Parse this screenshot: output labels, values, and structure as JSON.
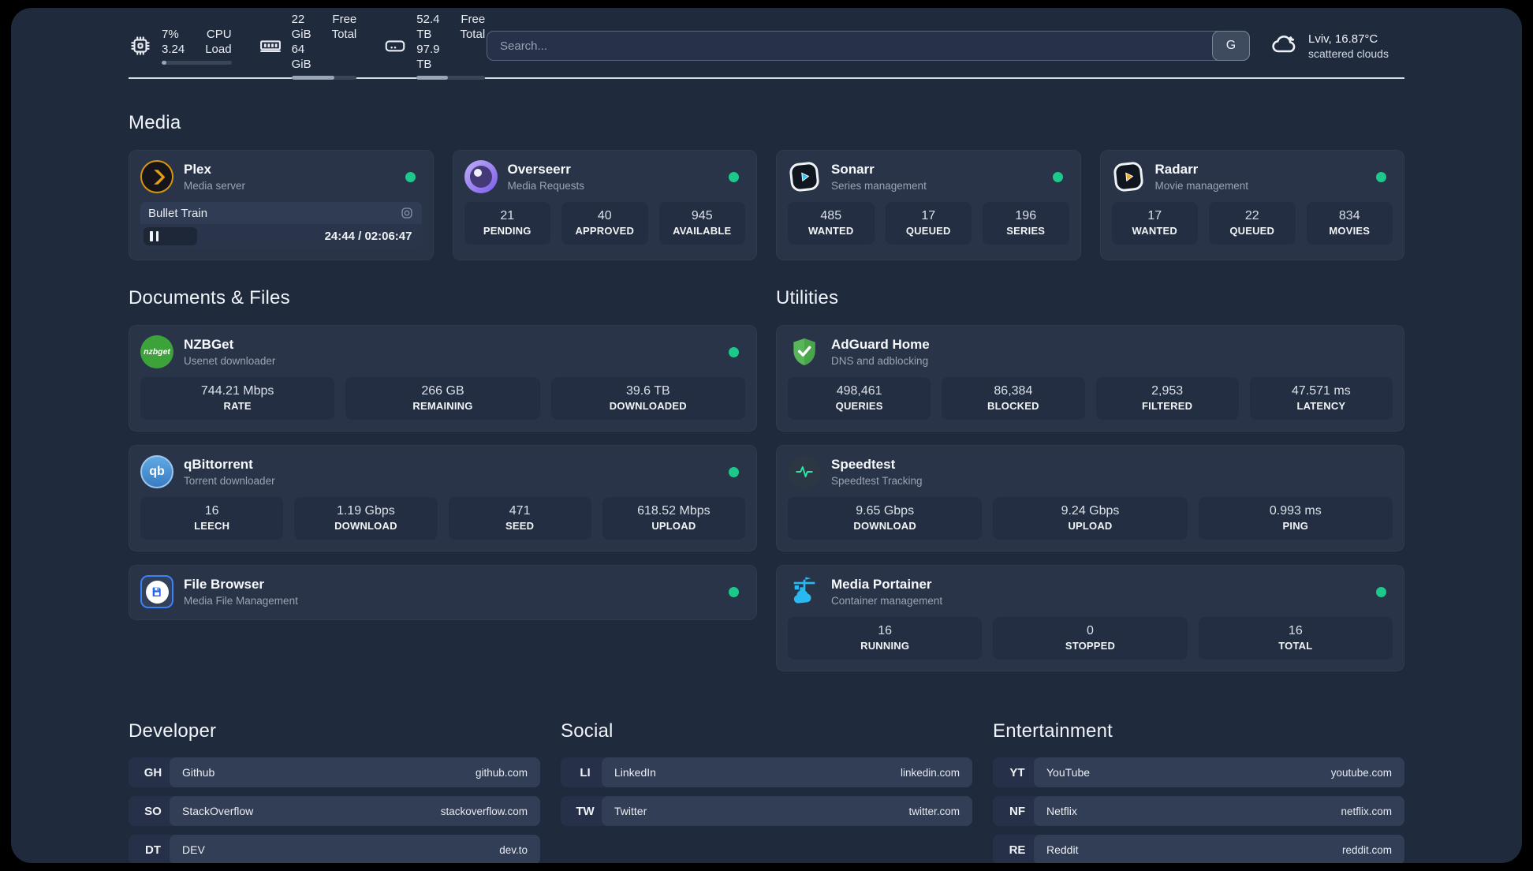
{
  "header": {
    "system_stats": [
      {
        "icon": "cpu-icon",
        "values": [
          "7%",
          "3.24"
        ],
        "labels": [
          "CPU",
          "Load"
        ],
        "progress": "7%"
      },
      {
        "icon": "memory-icon",
        "values": [
          "22 GiB",
          "64 GiB"
        ],
        "labels": [
          "Free",
          "Total"
        ],
        "progress": "66%"
      },
      {
        "icon": "disk-icon",
        "values": [
          "52.4 TB",
          "97.9 TB"
        ],
        "labels": [
          "Free",
          "Total"
        ],
        "progress": "46%"
      }
    ],
    "search": {
      "placeholder": "Search...",
      "button_label": "G"
    },
    "weather": {
      "location": "Lviv, 16.87°C",
      "condition": "scattered clouds"
    }
  },
  "sections": {
    "media": {
      "title": "Media",
      "plex": {
        "name": "Plex",
        "description": "Media server",
        "status": "online",
        "now_playing": {
          "title": "Bullet Train",
          "time_display": "24:44 / 02:06:47",
          "progress": "19%",
          "state": "paused"
        }
      },
      "overseerr": {
        "name": "Overseerr",
        "description": "Media Requests",
        "status": "online",
        "stats": [
          {
            "value": "21",
            "label": "PENDING"
          },
          {
            "value": "40",
            "label": "APPROVED"
          },
          {
            "value": "945",
            "label": "AVAILABLE"
          }
        ]
      },
      "sonarr": {
        "name": "Sonarr",
        "description": "Series management",
        "status": "online",
        "stats": [
          {
            "value": "485",
            "label": "WANTED"
          },
          {
            "value": "17",
            "label": "QUEUED"
          },
          {
            "value": "196",
            "label": "SERIES"
          }
        ]
      },
      "radarr": {
        "name": "Radarr",
        "description": "Movie management",
        "status": "online",
        "stats": [
          {
            "value": "17",
            "label": "WANTED"
          },
          {
            "value": "22",
            "label": "QUEUED"
          },
          {
            "value": "834",
            "label": "MOVIES"
          }
        ]
      }
    },
    "documents": {
      "title": "Documents & Files",
      "nzbget": {
        "name": "NZBGet",
        "description": "Usenet downloader",
        "status": "online",
        "icon_text": "nzbget",
        "stats": [
          {
            "value": "744.21 Mbps",
            "label": "RATE"
          },
          {
            "value": "266 GB",
            "label": "REMAINING"
          },
          {
            "value": "39.6 TB",
            "label": "DOWNLOADED"
          }
        ]
      },
      "qbittorrent": {
        "name": "qBittorrent",
        "description": "Torrent downloader",
        "status": "online",
        "icon_text": "qb",
        "stats": [
          {
            "value": "16",
            "label": "LEECH"
          },
          {
            "value": "1.19 Gbps",
            "label": "DOWNLOAD"
          },
          {
            "value": "471",
            "label": "SEED"
          },
          {
            "value": "618.52 Mbps",
            "label": "UPLOAD"
          }
        ]
      },
      "filebrowser": {
        "name": "File Browser",
        "description": "Media File Management",
        "status": "online"
      }
    },
    "utilities": {
      "title": "Utilities",
      "adguard": {
        "name": "AdGuard Home",
        "description": "DNS and adblocking",
        "stats": [
          {
            "value": "498,461",
            "label": "QUERIES"
          },
          {
            "value": "86,384",
            "label": "BLOCKED"
          },
          {
            "value": "2,953",
            "label": "FILTERED"
          },
          {
            "value": "47.571 ms",
            "label": "LATENCY"
          }
        ]
      },
      "speedtest": {
        "name": "Speedtest",
        "description": "Speedtest Tracking",
        "stats": [
          {
            "value": "9.65 Gbps",
            "label": "DOWNLOAD"
          },
          {
            "value": "9.24 Gbps",
            "label": "UPLOAD"
          },
          {
            "value": "0.993 ms",
            "label": "PING"
          }
        ]
      },
      "portainer": {
        "name": "Media Portainer",
        "description": "Container management",
        "status": "online",
        "stats": [
          {
            "value": "16",
            "label": "RUNNING"
          },
          {
            "value": "0",
            "label": "STOPPED"
          },
          {
            "value": "16",
            "label": "TOTAL"
          }
        ]
      }
    },
    "developer": {
      "title": "Developer",
      "links": [
        {
          "abbr": "GH",
          "name": "Github",
          "url": "github.com"
        },
        {
          "abbr": "SO",
          "name": "StackOverflow",
          "url": "stackoverflow.com"
        },
        {
          "abbr": "DT",
          "name": "DEV",
          "url": "dev.to"
        }
      ]
    },
    "social": {
      "title": "Social",
      "links": [
        {
          "abbr": "LI",
          "name": "LinkedIn",
          "url": "linkedin.com"
        },
        {
          "abbr": "TW",
          "name": "Twitter",
          "url": "twitter.com"
        }
      ]
    },
    "entertainment": {
      "title": "Entertainment",
      "links": [
        {
          "abbr": "YT",
          "name": "YouTube",
          "url": "youtube.com"
        },
        {
          "abbr": "NF",
          "name": "Netflix",
          "url": "netflix.com"
        },
        {
          "abbr": "RE",
          "name": "Reddit",
          "url": "reddit.com"
        }
      ]
    }
  },
  "colors": {
    "status_online": "#1dc98a",
    "plex_accent": "#e5a00d",
    "sonarr_accent": "#35c5f4",
    "radarr_accent": "#f9a825",
    "panel_bg": "#1f2a3d"
  }
}
